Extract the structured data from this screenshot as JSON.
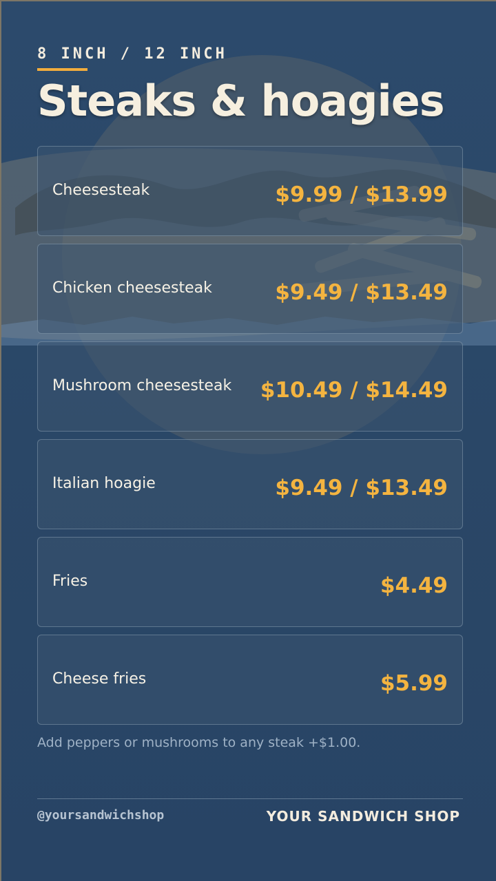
{
  "header": {
    "subtitle": "8 INCH / 12 INCH",
    "title": "Steaks & hoagies"
  },
  "menu": {
    "items": [
      {
        "name": "Cheesesteak",
        "price": "$9.99 / $13.99"
      },
      {
        "name": "Chicken cheesesteak",
        "price": "$9.49 / $13.49"
      },
      {
        "name": "Mushroom cheesesteak",
        "price": "$10.49 / $14.49"
      },
      {
        "name": "Italian hoagie",
        "price": "$9.49 / $13.49"
      },
      {
        "name": "Fries",
        "price": "$4.49"
      },
      {
        "name": "Cheese fries",
        "price": "$5.99"
      }
    ],
    "note": "Add peppers or mushrooms to any steak +$1.00."
  },
  "footer": {
    "handle": "@yoursandwichshop",
    "shop_name": "YOUR SANDWICH SHOP"
  },
  "colors": {
    "background": "#2a4868",
    "accent": "#f4b440",
    "text": "#f7f2e6"
  }
}
